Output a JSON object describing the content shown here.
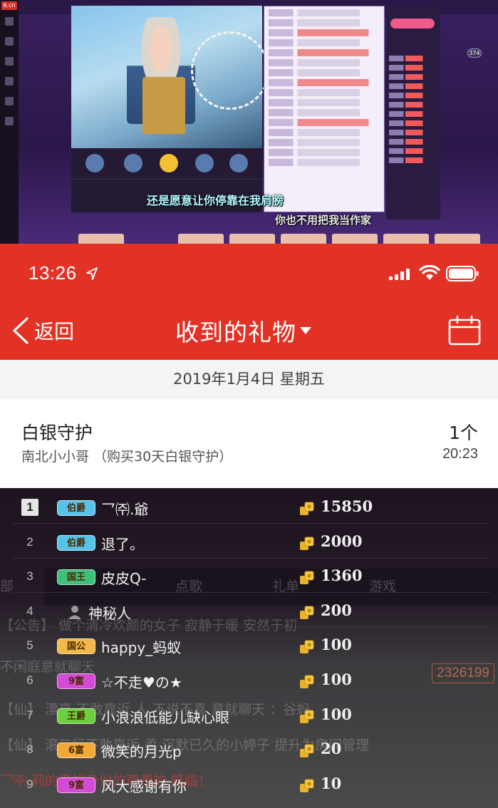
{
  "desktop_screenshot": {
    "logo": "6.cn",
    "subtitle_lines": [
      "还是愿意让你停靠在我肩膀",
      "你也不用把我当作家"
    ],
    "viewer_badge": "374"
  },
  "status_bar": {
    "time": "13:26",
    "icons": [
      "location-arrow-icon",
      "cellular-signal-icon",
      "wifi-icon",
      "battery-icon"
    ]
  },
  "nav": {
    "back_label": "返回",
    "title": "收到的礼物",
    "title_dropdown_icon": "caret-down-icon",
    "calendar_icon": "calendar-icon"
  },
  "date_header": "2019年1月4日 星期五",
  "gift_record": {
    "name": "白银守护",
    "description": "南北小小哥 （购买30天白银守护）",
    "count": "1个",
    "time": "20:23"
  },
  "ranking": {
    "rows": [
      {
        "rank": "1",
        "badge": "伯爵",
        "badge_color": "#58c3e8",
        "name": "乛㈜.爺",
        "amount": "15850"
      },
      {
        "rank": "2",
        "badge": "伯爵",
        "badge_color": "#58c3e8",
        "name": "退了。",
        "amount": "2000"
      },
      {
        "rank": "3",
        "badge": "国王",
        "badge_color": "#3fc07a",
        "name": "皮皮Q-",
        "amount": "1360"
      },
      {
        "rank": "4",
        "badge": "",
        "badge_color": "",
        "name": "神秘人",
        "amount": "200"
      },
      {
        "rank": "5",
        "badge": "国公",
        "badge_color": "#f2b84a",
        "name": "happy_蚂蚁",
        "amount": "100"
      },
      {
        "rank": "6",
        "badge": "9富",
        "badge_color": "#d54bd8",
        "name": "☆不走♥の★",
        "amount": "100"
      },
      {
        "rank": "7",
        "badge": "王爵",
        "badge_color": "#6ccf3f",
        "name": "小浪浪低能儿缺心眼",
        "amount": "100"
      },
      {
        "rank": "8",
        "badge": "6富",
        "badge_color": "#f3a93a",
        "name": "微笑的月光p",
        "amount": "20"
      },
      {
        "rank": "9",
        "badge": "9富",
        "badge_color": "#d54bd8",
        "name": "风大感谢有你",
        "amount": "10"
      }
    ],
    "background_tabs": [
      "部",
      "点歌",
      "礼单",
      "游戏"
    ],
    "background_id": "2326199",
    "background_lines": [
      "【公告】 做个清冷欢颜的女子 寂静于暖 安然于初",
      "不闲庭意就聊天",
      "【仙】 漂亮 不敢靠近 人 不说不喜 意就聊天 ：谷蚂",
      "【仙】 滚三行不敢靠近 柔 沉默已久的小婷子 提升为房间管理",
      "乛㈜ 莉的贵族身份的尊贵的 降临！"
    ]
  }
}
